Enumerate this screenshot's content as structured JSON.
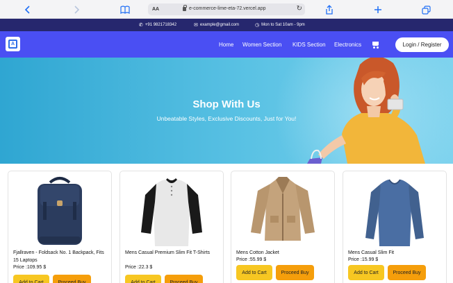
{
  "browser": {
    "text_size_label": "AA",
    "url": "e-commerce-lime-eta-72.vercel.app"
  },
  "infobar": {
    "phone": "+91 9821718342",
    "email": "example@gmail.com",
    "hours": "Mon to Sat 10am - 9pm"
  },
  "nav": {
    "links": [
      "Home",
      "Women Section",
      "KIDS Section",
      "Electronics"
    ],
    "login_label": "Login / Register"
  },
  "hero": {
    "title": "Shop With Us",
    "subtitle": "Unbeatable Styles, Exclusive Discounts, Just for You!"
  },
  "products": [
    {
      "name": "Fjallraven - Foldsack No. 1 Backpack, Fits 15 Laptops",
      "price": "Price :109.95 $",
      "add_label": "Add to Cart",
      "buy_label": "Proceed Buy"
    },
    {
      "name": "Mens Casual Premium Slim Fit T-Shirts",
      "price": "Price :22.3 $",
      "add_label": "Add to Cart",
      "buy_label": "Proceed Buy"
    },
    {
      "name": "Mens Cotton Jacket",
      "price": "Price :55.99 $",
      "add_label": "Add to Cart",
      "buy_label": "Proceed Buy"
    },
    {
      "name": "Mens Casual Slim Fit",
      "price": "Price :15.99 $",
      "add_label": "Add to Cart",
      "buy_label": "Proceed Buy"
    }
  ],
  "colors": {
    "infobar": "#26276e",
    "nav": "#4a4ff3",
    "add_button": "#f7c722",
    "buy_button": "#f59e0b"
  }
}
